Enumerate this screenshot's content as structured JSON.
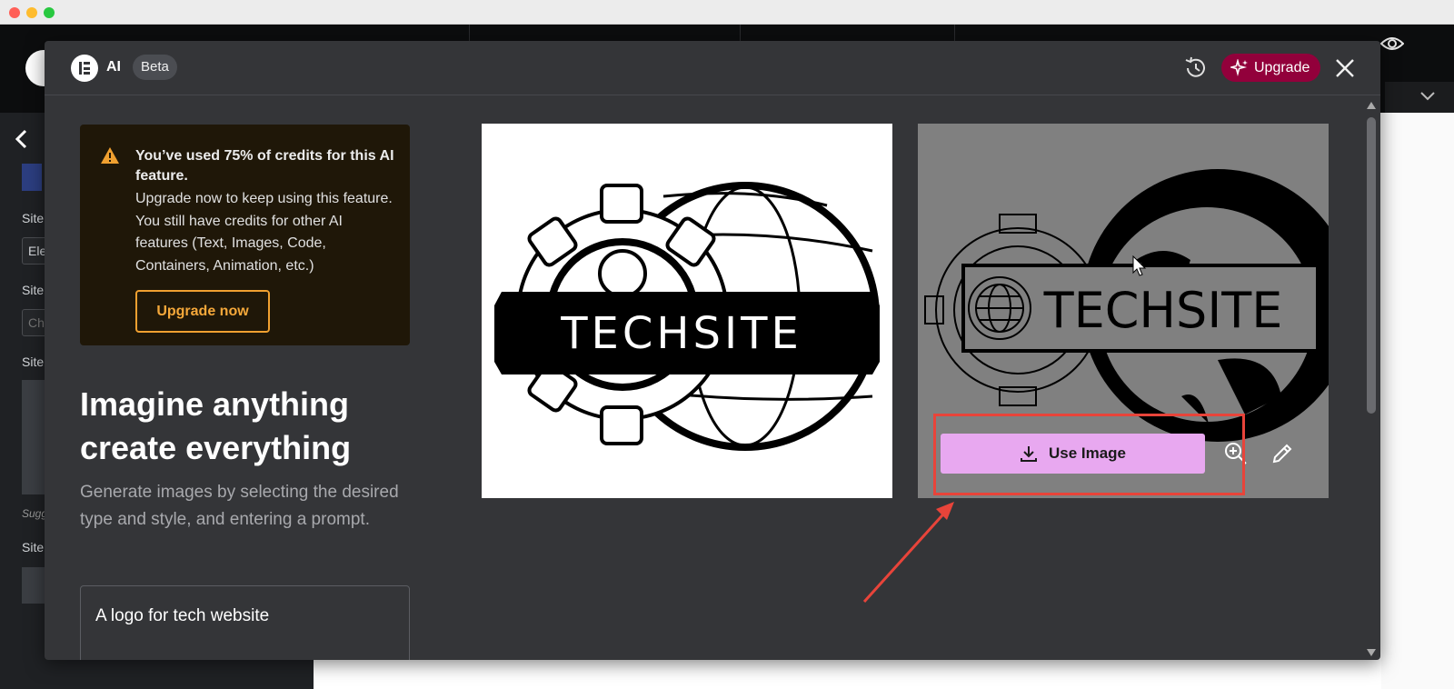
{
  "modal": {
    "title": "AI",
    "badge": "Beta",
    "upgrade_label": "Upgrade",
    "colors": {
      "background": "#343538",
      "upgrade_bg": "#92003b",
      "use_image_bg": "#e8a8f0",
      "credit_box_bg": "#1f1708",
      "accent_orange": "#f0a030"
    }
  },
  "credits": {
    "title": "You’ve used 75% of credits for this AI feature.",
    "body": "Upgrade now to keep using this feature. You still have credits for other AI features (Text, Images, Code, Containers, Animation, etc.)",
    "button": "Upgrade now"
  },
  "intro": {
    "headline_line1": "Imagine anything",
    "headline_line2": "create everything",
    "subtext": "Generate images by selecting the desired type and style, and entering a prompt."
  },
  "prompt": {
    "value": "A logo for tech website"
  },
  "results": [
    {
      "logo_text": "TECHSITE"
    },
    {
      "logo_text": "TECHSITE"
    }
  ],
  "actions": {
    "use_image": "Use Image"
  },
  "icons": [
    "elementor-logo-icon",
    "history-icon",
    "sparkle-icon",
    "close-icon",
    "warning-icon",
    "download-icon",
    "zoom-in-icon",
    "pencil-icon",
    "chevron-left-icon",
    "eye-icon",
    "chevron-down-icon"
  ],
  "background_editor": {
    "sidebar_labels": [
      "Site",
      "Site",
      "Site",
      "Sugg",
      "Site"
    ],
    "field_values": [
      "Ele",
      "Ch"
    ]
  }
}
